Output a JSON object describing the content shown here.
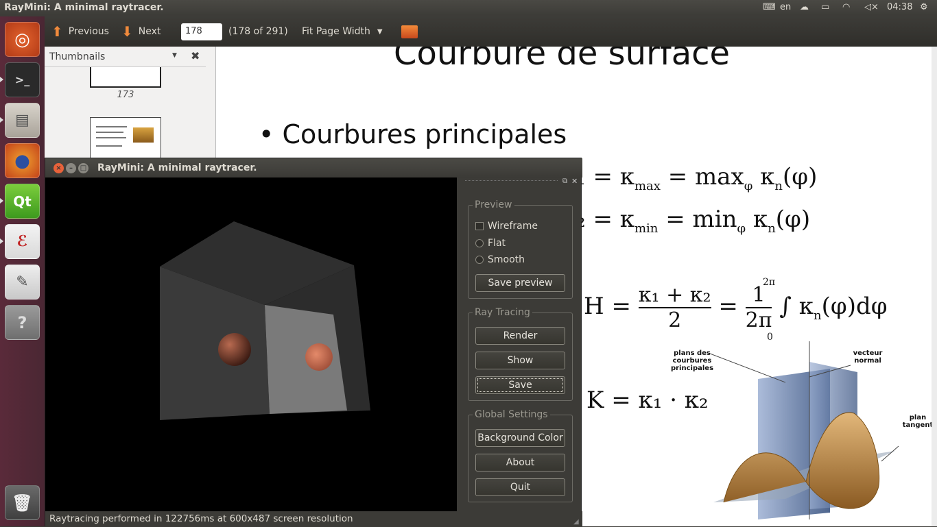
{
  "topbar": {
    "title": "RayMini: A minimal raytracer.",
    "keyboard": "en",
    "time": "04:38"
  },
  "evince": {
    "previous_label": "Previous",
    "next_label": "Next",
    "page_value": "178",
    "page_count": "(178 of 291)",
    "zoom": "Fit Page Width"
  },
  "sidebar": {
    "title": "Thumbnails",
    "thumbs": [
      {
        "label": "173"
      }
    ]
  },
  "document": {
    "title": "Courbure de surface",
    "bullet": "Courbures principales",
    "fig_label_planes": "plans des courbures principales",
    "fig_label_normal": "vecteur normal",
    "fig_label_tangent": "plan tangent"
  },
  "raymini": {
    "title": "RayMini: A minimal raytracer.",
    "preview_group": "Preview",
    "wireframe": "Wireframe",
    "flat": "Flat",
    "smooth": "Smooth",
    "save_preview": "Save preview",
    "ray_group": "Ray Tracing",
    "render": "Render",
    "show": "Show",
    "save": "Save",
    "global_group": "Global Settings",
    "bg_color": "Background Color",
    "about": "About",
    "quit": "Quit",
    "status": "Raytracing performed in 122756ms at 600x487 screen resolution"
  }
}
